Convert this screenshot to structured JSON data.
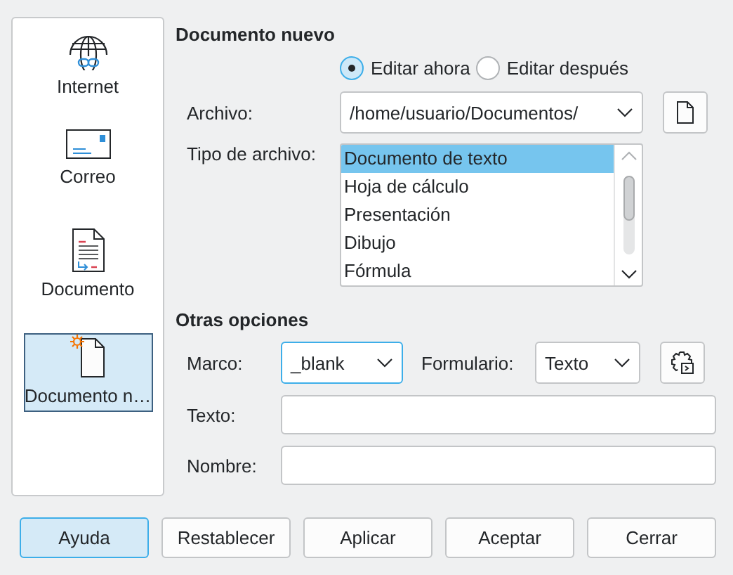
{
  "sidebar": {
    "items": [
      {
        "label": "Internet",
        "kind": "globe",
        "selected": false
      },
      {
        "label": "Correo",
        "kind": "mail",
        "selected": false
      },
      {
        "label": "Documento",
        "kind": "document",
        "selected": false
      },
      {
        "label": "Documento n…",
        "kind": "new-document",
        "selected": true
      }
    ]
  },
  "new_document": {
    "title": "Documento nuevo",
    "edit_options": [
      {
        "label": "Editar ahora",
        "selected": true
      },
      {
        "label": "Editar después",
        "selected": false
      }
    ],
    "file": {
      "label": "Archivo:",
      "value": "/home/usuario/Documentos/"
    },
    "file_type": {
      "label": "Tipo de archivo:",
      "items": [
        {
          "label": "Documento de texto",
          "selected": true
        },
        {
          "label": "Hoja de cálculo",
          "selected": false
        },
        {
          "label": "Presentación",
          "selected": false
        },
        {
          "label": "Dibujo",
          "selected": false
        },
        {
          "label": "Fórmula",
          "selected": false
        }
      ]
    }
  },
  "other_options": {
    "title": "Otras opciones",
    "frame": {
      "label": "Marco:",
      "value": "_blank"
    },
    "form": {
      "label": "Formulario:",
      "value": "Texto"
    },
    "text": {
      "label": "Texto:"
    },
    "name": {
      "label": "Nombre:"
    }
  },
  "buttons": [
    {
      "label": "Ayuda",
      "kind": "help"
    },
    {
      "label": "Restablecer",
      "kind": "normal"
    },
    {
      "label": "Aplicar",
      "kind": "normal"
    },
    {
      "label": "Aceptar",
      "kind": "normal"
    },
    {
      "label": "Cerrar",
      "kind": "normal"
    }
  ]
}
